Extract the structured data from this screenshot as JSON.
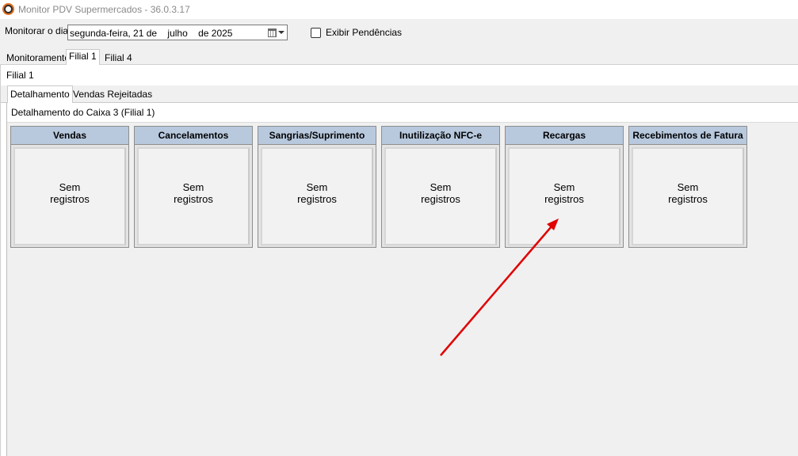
{
  "window": {
    "title": "Monitor PDV Supermercados - 36.0.3.17"
  },
  "toolbar": {
    "monitor_label": "Monitorar o dia",
    "date_value": "segunda-feira, 21 de    julho    de 2025",
    "show_pending_label": "Exibir Pendências",
    "show_pending_checked": false
  },
  "top_tabs": [
    {
      "label": "Monitoramento"
    },
    {
      "label": "Filial 1"
    },
    {
      "label": "Filial 4"
    }
  ],
  "filial_page": {
    "title": "Filial 1",
    "inner_tabs": [
      {
        "label": "Detalhamento"
      },
      {
        "label": "Vendas Rejeitadas"
      }
    ],
    "detail_title": "Detalhamento do Caixa 3 (Filial 1)"
  },
  "cards": [
    {
      "title": "Vendas",
      "body_line1": "Sem",
      "body_line2": "registros"
    },
    {
      "title": "Cancelamentos",
      "body_line1": "Sem",
      "body_line2": "registros"
    },
    {
      "title": "Sangrias/Suprimento",
      "body_line1": "Sem",
      "body_line2": "registros"
    },
    {
      "title": "Inutilização NFC-e",
      "body_line1": "Sem",
      "body_line2": "registros"
    },
    {
      "title": "Recargas",
      "body_line1": "Sem",
      "body_line2": "registros"
    },
    {
      "title": "Recebimentos de Fatura",
      "body_line1": "Sem",
      "body_line2": "registros"
    }
  ],
  "colors": {
    "card_header": "#b8c9de",
    "annotation_arrow": "#e00000"
  }
}
